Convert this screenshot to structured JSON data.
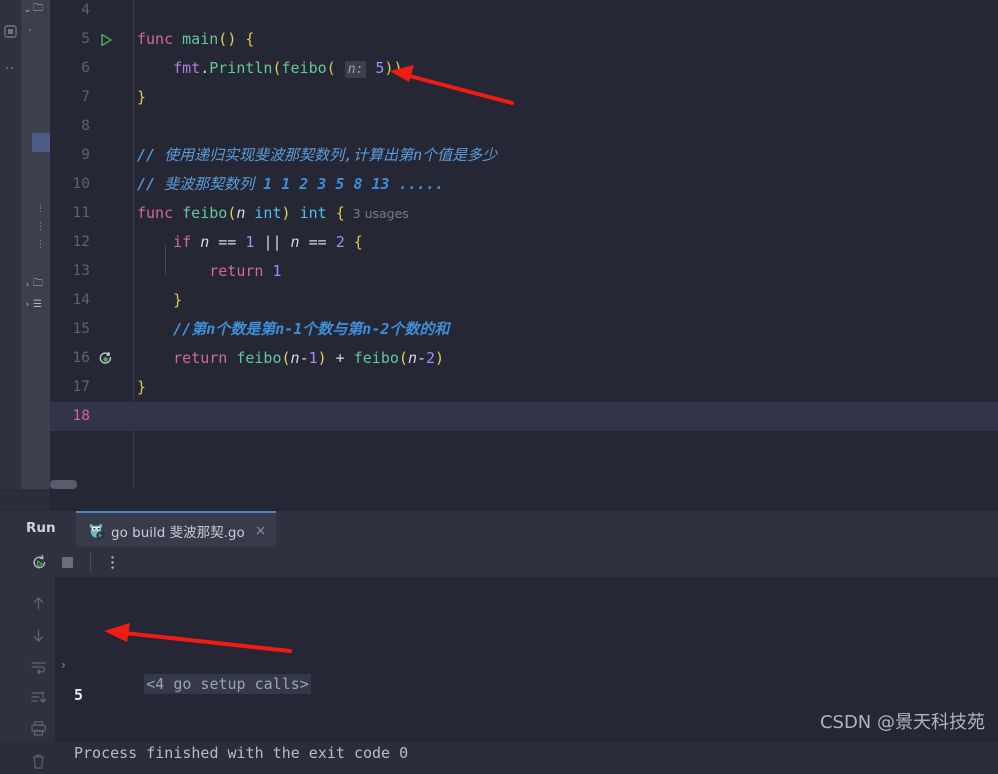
{
  "editor": {
    "lines": [
      {
        "num": "4",
        "tokens": []
      },
      {
        "num": "5",
        "gutter_icon": "run-gutter-icon",
        "tokens": [
          {
            "t": "func",
            "c": "kw"
          },
          {
            "t": " ",
            "c": "op"
          },
          {
            "t": "main",
            "c": "fn"
          },
          {
            "t": "(",
            "c": "par"
          },
          {
            "t": ")",
            "c": "par"
          },
          {
            "t": " ",
            "c": "op"
          },
          {
            "t": "{",
            "c": "par2"
          }
        ]
      },
      {
        "num": "6",
        "tokens": [
          {
            "t": "    ",
            "c": "op"
          },
          {
            "t": "fmt",
            "c": "pkg"
          },
          {
            "t": ".",
            "c": "op"
          },
          {
            "t": "Println",
            "c": "fn"
          },
          {
            "t": "(",
            "c": "par"
          },
          {
            "t": "feibo",
            "c": "fn"
          },
          {
            "t": "(",
            "c": "par2"
          },
          {
            "t": " ",
            "c": "op"
          },
          {
            "t": "n:",
            "c": "phint"
          },
          {
            "t": " ",
            "c": "op"
          },
          {
            "t": "5",
            "c": "num"
          },
          {
            "t": ")",
            "c": "par2"
          },
          {
            "t": ")",
            "c": "par"
          }
        ]
      },
      {
        "num": "7",
        "tokens": [
          {
            "t": "}",
            "c": "par2"
          }
        ]
      },
      {
        "num": "8",
        "tokens": []
      },
      {
        "num": "9",
        "tokens": [
          {
            "t": "// ",
            "c": "cmt-b"
          },
          {
            "t": "使用递归实现斐波那契数列,计算出第n个值是多少",
            "c": "cmt"
          }
        ]
      },
      {
        "num": "10",
        "tokens": [
          {
            "t": "// ",
            "c": "cmt-b"
          },
          {
            "t": "斐波那契数列 ",
            "c": "cmt"
          },
          {
            "t": "1 1 2 3 5 8 13 .....",
            "c": "cmt-n"
          }
        ]
      },
      {
        "num": "11",
        "tokens": [
          {
            "t": "func",
            "c": "kw"
          },
          {
            "t": " ",
            "c": "op"
          },
          {
            "t": "feibo",
            "c": "fn"
          },
          {
            "t": "(",
            "c": "par"
          },
          {
            "t": "n",
            "c": "param"
          },
          {
            "t": " ",
            "c": "op"
          },
          {
            "t": "int",
            "c": "typ"
          },
          {
            "t": ")",
            "c": "par"
          },
          {
            "t": " ",
            "c": "op"
          },
          {
            "t": "int",
            "c": "typ"
          },
          {
            "t": " ",
            "c": "op"
          },
          {
            "t": "{",
            "c": "par2"
          },
          {
            "t": "  3 usages",
            "c": "hint"
          }
        ]
      },
      {
        "num": "12",
        "tokens": [
          {
            "t": "    ",
            "c": "op"
          },
          {
            "t": "if",
            "c": "kw"
          },
          {
            "t": " ",
            "c": "op"
          },
          {
            "t": "n",
            "c": "param"
          },
          {
            "t": " == ",
            "c": "op"
          },
          {
            "t": "1",
            "c": "num"
          },
          {
            "t": " ",
            "c": "op"
          },
          {
            "t": "||",
            "c": "op"
          },
          {
            "t": " ",
            "c": "op"
          },
          {
            "t": "n",
            "c": "param"
          },
          {
            "t": " == ",
            "c": "op"
          },
          {
            "t": "2",
            "c": "num"
          },
          {
            "t": " ",
            "c": "op"
          },
          {
            "t": "{",
            "c": "par2"
          }
        ]
      },
      {
        "num": "13",
        "tokens": [
          {
            "t": "        ",
            "c": "op"
          },
          {
            "t": "return",
            "c": "kw"
          },
          {
            "t": " ",
            "c": "op"
          },
          {
            "t": "1",
            "c": "num"
          }
        ]
      },
      {
        "num": "14",
        "tokens": [
          {
            "t": "    ",
            "c": "op"
          },
          {
            "t": "}",
            "c": "par2"
          }
        ]
      },
      {
        "num": "15",
        "tokens": [
          {
            "t": "    ",
            "c": "op"
          },
          {
            "t": "//",
            "c": "cmt-b"
          },
          {
            "t": "第n个数是第n-1个数与第n-2个数的和",
            "c": "cmt-n"
          }
        ]
      },
      {
        "num": "16",
        "gutter_icon": "recursion-gutter-icon",
        "tokens": [
          {
            "t": "    ",
            "c": "op"
          },
          {
            "t": "return",
            "c": "kw"
          },
          {
            "t": " ",
            "c": "op"
          },
          {
            "t": "feibo",
            "c": "fn"
          },
          {
            "t": "(",
            "c": "par"
          },
          {
            "t": "n",
            "c": "param"
          },
          {
            "t": "-",
            "c": "op"
          },
          {
            "t": "1",
            "c": "num"
          },
          {
            "t": ")",
            "c": "par"
          },
          {
            "t": " + ",
            "c": "op"
          },
          {
            "t": "feibo",
            "c": "fn"
          },
          {
            "t": "(",
            "c": "par"
          },
          {
            "t": "n",
            "c": "param"
          },
          {
            "t": "-",
            "c": "op"
          },
          {
            "t": "2",
            "c": "num"
          },
          {
            "t": ")",
            "c": "par"
          }
        ]
      },
      {
        "num": "17",
        "tokens": [
          {
            "t": "}",
            "c": "par2"
          }
        ]
      },
      {
        "num": "18",
        "current": true,
        "tokens": []
      }
    ]
  },
  "run_panel": {
    "title": "Run",
    "tab": {
      "label": "go build 斐波那契.go",
      "close": "×"
    },
    "toolbar": {
      "rerun": "rerun-icon",
      "stop": "stop-icon",
      "more": "more-options-icon"
    },
    "console_gutter": [
      "up-arrow-icon",
      "down-arrow-icon",
      "soft-wrap-icon",
      "scroll-to-end-icon",
      "print-icon",
      "trash-icon"
    ],
    "console": {
      "fold_marker": "›",
      "setup_line": "<4 go setup calls>",
      "output_value": "5",
      "finish_line": "Process finished with the exit code 0"
    }
  },
  "watermark": {
    "text": "CSDN @景天科技苑"
  },
  "annotations": {
    "arrow_1": "red-arrow-pointing-to-argument",
    "arrow_2": "red-arrow-pointing-to-output"
  },
  "colors": {
    "editor_bg": "#252734",
    "panel_bg": "#2f313e",
    "accent": "#4b83d8",
    "arrow_red": "#f01c14",
    "current_line": "#32344a"
  }
}
